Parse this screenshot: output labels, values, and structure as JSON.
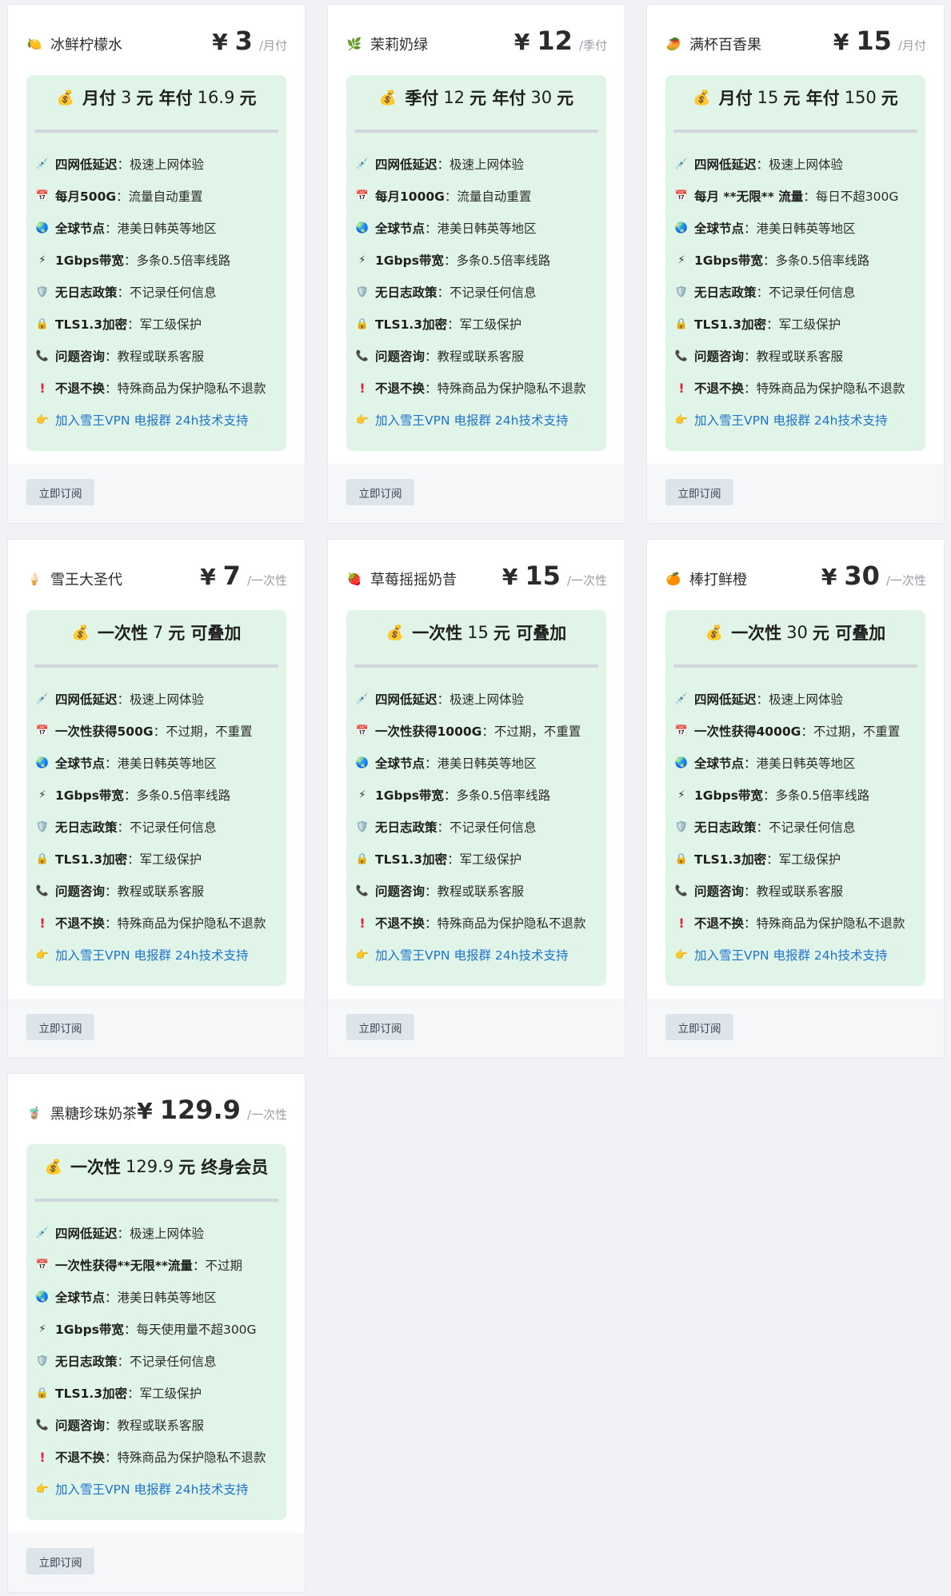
{
  "subscribe_label": "立即订阅",
  "cards": [
    {
      "name": "冰鲜柠檬水",
      "icon": "lemon-icon",
      "icon_glyph": "🍋",
      "currency": "¥",
      "price": "3",
      "unit": "/月付",
      "summary": {
        "prefix": "月付",
        "num1": "3",
        "mid": "元 年付",
        "num2": "16.9",
        "suffix": "元"
      },
      "features": [
        {
          "icon": "syringe-icon",
          "glyph": "💉",
          "bold": "四网低延迟",
          "sep": "：",
          "text": "极速上网体验"
        },
        {
          "icon": "calendar-icon",
          "glyph": "📅",
          "bold": "每月500G",
          "sep": "：",
          "text": "流量自动重置"
        },
        {
          "icon": "globe-icon",
          "glyph": "🌏",
          "bold": "全球节点",
          "sep": "：",
          "text": "港美日韩英等地区"
        },
        {
          "icon": "lightning-icon",
          "glyph": "⚡",
          "bold": "1Gbps带宽",
          "sep": "：",
          "text": "多条0.5倍率线路"
        },
        {
          "icon": "shield-icon",
          "glyph": "🛡️",
          "bold": "无日志政策",
          "sep": "：",
          "text": "不记录任何信息"
        },
        {
          "icon": "lock-icon",
          "glyph": "🔒",
          "bold": "TLS1.3加密",
          "sep": "：",
          "text": "军工级保护"
        },
        {
          "icon": "phone-icon",
          "glyph": "📞",
          "bold": "问题咨询",
          "sep": "：",
          "text": "教程或联系客服"
        },
        {
          "icon": "exclamation-icon",
          "glyph": "!",
          "bold": "不退不换",
          "sep": "：",
          "text": "特殊商品为保护隐私不退款"
        }
      ],
      "link": {
        "icon": "pointing-hand-icon",
        "glyph": "👉",
        "text": "加入雪王VPN 电报群 24h技术支持"
      }
    },
    {
      "name": "茉莉奶绿",
      "icon": "herb-icon",
      "icon_glyph": "🌿",
      "currency": "¥",
      "price": "12",
      "unit": "/季付",
      "summary": {
        "prefix": "季付",
        "num1": "12",
        "mid": "元 年付",
        "num2": "30",
        "suffix": "元"
      },
      "features": [
        {
          "icon": "syringe-icon",
          "glyph": "💉",
          "bold": "四网低延迟",
          "sep": "：",
          "text": "极速上网体验"
        },
        {
          "icon": "calendar-icon",
          "glyph": "📅",
          "bold": "每月1000G",
          "sep": "：",
          "text": "流量自动重置"
        },
        {
          "icon": "globe-icon",
          "glyph": "🌏",
          "bold": "全球节点",
          "sep": "：",
          "text": "港美日韩英等地区"
        },
        {
          "icon": "lightning-icon",
          "glyph": "⚡",
          "bold": "1Gbps带宽",
          "sep": "：",
          "text": "多条0.5倍率线路"
        },
        {
          "icon": "shield-icon",
          "glyph": "🛡️",
          "bold": "无日志政策",
          "sep": "：",
          "text": "不记录任何信息"
        },
        {
          "icon": "lock-icon",
          "glyph": "🔒",
          "bold": "TLS1.3加密",
          "sep": "：",
          "text": "军工级保护"
        },
        {
          "icon": "phone-icon",
          "glyph": "📞",
          "bold": "问题咨询",
          "sep": "：",
          "text": "教程或联系客服"
        },
        {
          "icon": "exclamation-icon",
          "glyph": "!",
          "bold": "不退不换",
          "sep": "：",
          "text": "特殊商品为保护隐私不退款"
        }
      ],
      "link": {
        "icon": "pointing-hand-icon",
        "glyph": "👉",
        "text": "加入雪王VPN 电报群 24h技术支持"
      }
    },
    {
      "name": "满杯百香果",
      "icon": "mango-icon",
      "icon_glyph": "🥭",
      "currency": "¥",
      "price": "15",
      "unit": "/月付",
      "summary": {
        "prefix": "月付",
        "num1": "15",
        "mid": "元 年付",
        "num2": "150",
        "suffix": "元"
      },
      "features": [
        {
          "icon": "syringe-icon",
          "glyph": "💉",
          "bold": "四网低延迟",
          "sep": "：",
          "text": "极速上网体验"
        },
        {
          "icon": "calendar-icon",
          "glyph": "📅",
          "bold": "每月 **无限** 流量",
          "sep": "：",
          "text": "每日不超300G"
        },
        {
          "icon": "globe-icon",
          "glyph": "🌏",
          "bold": "全球节点",
          "sep": "：",
          "text": "港美日韩英等地区"
        },
        {
          "icon": "lightning-icon",
          "glyph": "⚡",
          "bold": "1Gbps带宽",
          "sep": "：",
          "text": "多条0.5倍率线路"
        },
        {
          "icon": "shield-icon",
          "glyph": "🛡️",
          "bold": "无日志政策",
          "sep": "：",
          "text": "不记录任何信息"
        },
        {
          "icon": "lock-icon",
          "glyph": "🔒",
          "bold": "TLS1.3加密",
          "sep": "：",
          "text": "军工级保护"
        },
        {
          "icon": "phone-icon",
          "glyph": "📞",
          "bold": "问题咨询",
          "sep": "：",
          "text": "教程或联系客服"
        },
        {
          "icon": "exclamation-icon",
          "glyph": "!",
          "bold": "不退不换",
          "sep": "：",
          "text": "特殊商品为保护隐私不退款"
        }
      ],
      "link": {
        "icon": "pointing-hand-icon",
        "glyph": "👉",
        "text": "加入雪王VPN 电报群 24h技术支持"
      }
    },
    {
      "name": "雪王大圣代",
      "icon": "ice-cream-icon",
      "icon_glyph": "🍦",
      "currency": "¥",
      "price": "7",
      "unit": "/一次性",
      "summary": {
        "prefix": "一次性",
        "num1": "7",
        "mid": "元 可叠加",
        "num2": "",
        "suffix": ""
      },
      "features": [
        {
          "icon": "syringe-icon",
          "glyph": "💉",
          "bold": "四网低延迟",
          "sep": "：",
          "text": "极速上网体验"
        },
        {
          "icon": "calendar-icon",
          "glyph": "📅",
          "bold": "一次性获得500G",
          "sep": "：",
          "text": "不过期，不重置"
        },
        {
          "icon": "globe-icon",
          "glyph": "🌏",
          "bold": "全球节点",
          "sep": "：",
          "text": "港美日韩英等地区"
        },
        {
          "icon": "lightning-icon",
          "glyph": "⚡",
          "bold": "1Gbps带宽",
          "sep": "：",
          "text": "多条0.5倍率线路"
        },
        {
          "icon": "shield-icon",
          "glyph": "🛡️",
          "bold": "无日志政策",
          "sep": "：",
          "text": "不记录任何信息"
        },
        {
          "icon": "lock-icon",
          "glyph": "🔒",
          "bold": "TLS1.3加密",
          "sep": "：",
          "text": "军工级保护"
        },
        {
          "icon": "phone-icon",
          "glyph": "📞",
          "bold": "问题咨询",
          "sep": "：",
          "text": "教程或联系客服"
        },
        {
          "icon": "exclamation-icon",
          "glyph": "!",
          "bold": "不退不换",
          "sep": "：",
          "text": "特殊商品为保护隐私不退款"
        }
      ],
      "link": {
        "icon": "pointing-hand-icon",
        "glyph": "👉",
        "text": "加入雪王VPN 电报群 24h技术支持"
      }
    },
    {
      "name": "草莓摇摇奶昔",
      "icon": "strawberry-icon",
      "icon_glyph": "🍓",
      "currency": "¥",
      "price": "15",
      "unit": "/一次性",
      "summary": {
        "prefix": "一次性",
        "num1": "15",
        "mid": "元 可叠加",
        "num2": "",
        "suffix": ""
      },
      "features": [
        {
          "icon": "syringe-icon",
          "glyph": "💉",
          "bold": "四网低延迟",
          "sep": "：",
          "text": "极速上网体验"
        },
        {
          "icon": "calendar-icon",
          "glyph": "📅",
          "bold": "一次性获得1000G",
          "sep": "：",
          "text": "不过期，不重置"
        },
        {
          "icon": "globe-icon",
          "glyph": "🌏",
          "bold": "全球节点",
          "sep": "：",
          "text": "港美日韩英等地区"
        },
        {
          "icon": "lightning-icon",
          "glyph": "⚡",
          "bold": "1Gbps带宽",
          "sep": "：",
          "text": "多条0.5倍率线路"
        },
        {
          "icon": "shield-icon",
          "glyph": "🛡️",
          "bold": "无日志政策",
          "sep": "：",
          "text": "不记录任何信息"
        },
        {
          "icon": "lock-icon",
          "glyph": "🔒",
          "bold": "TLS1.3加密",
          "sep": "：",
          "text": "军工级保护"
        },
        {
          "icon": "phone-icon",
          "glyph": "📞",
          "bold": "问题咨询",
          "sep": "：",
          "text": "教程或联系客服"
        },
        {
          "icon": "exclamation-icon",
          "glyph": "!",
          "bold": "不退不换",
          "sep": "：",
          "text": "特殊商品为保护隐私不退款"
        }
      ],
      "link": {
        "icon": "pointing-hand-icon",
        "glyph": "👉",
        "text": "加入雪王VPN 电报群 24h技术支持"
      }
    },
    {
      "name": "棒打鲜橙",
      "icon": "orange-icon",
      "icon_glyph": "🍊",
      "currency": "¥",
      "price": "30",
      "unit": "/一次性",
      "summary": {
        "prefix": "一次性",
        "num1": "30",
        "mid": "元 可叠加",
        "num2": "",
        "suffix": ""
      },
      "features": [
        {
          "icon": "syringe-icon",
          "glyph": "💉",
          "bold": "四网低延迟",
          "sep": "：",
          "text": "极速上网体验"
        },
        {
          "icon": "calendar-icon",
          "glyph": "📅",
          "bold": "一次性获得4000G",
          "sep": "：",
          "text": "不过期，不重置"
        },
        {
          "icon": "globe-icon",
          "glyph": "🌏",
          "bold": "全球节点",
          "sep": "：",
          "text": "港美日韩英等地区"
        },
        {
          "icon": "lightning-icon",
          "glyph": "⚡",
          "bold": "1Gbps带宽",
          "sep": "：",
          "text": "多条0.5倍率线路"
        },
        {
          "icon": "shield-icon",
          "glyph": "🛡️",
          "bold": "无日志政策",
          "sep": "：",
          "text": "不记录任何信息"
        },
        {
          "icon": "lock-icon",
          "glyph": "🔒",
          "bold": "TLS1.3加密",
          "sep": "：",
          "text": "军工级保护"
        },
        {
          "icon": "phone-icon",
          "glyph": "📞",
          "bold": "问题咨询",
          "sep": "：",
          "text": "教程或联系客服"
        },
        {
          "icon": "exclamation-icon",
          "glyph": "!",
          "bold": "不退不换",
          "sep": "：",
          "text": "特殊商品为保护隐私不退款"
        }
      ],
      "link": {
        "icon": "pointing-hand-icon",
        "glyph": "👉",
        "text": "加入雪王VPN 电报群 24h技术支持"
      }
    },
    {
      "name": "黑糖珍珠奶茶",
      "icon": "bubble-tea-icon",
      "icon_glyph": "🧋",
      "currency": "¥",
      "price": "129.9",
      "unit": "/一次性",
      "summary": {
        "prefix": "一次性",
        "num1": "129.9",
        "mid": "元 终身会员",
        "num2": "",
        "suffix": ""
      },
      "features": [
        {
          "icon": "syringe-icon",
          "glyph": "💉",
          "bold": "四网低延迟",
          "sep": "：",
          "text": "极速上网体验"
        },
        {
          "icon": "calendar-icon",
          "glyph": "📅",
          "bold": "一次性获得**无限**流量",
          "sep": "：",
          "text": "不过期"
        },
        {
          "icon": "globe-icon",
          "glyph": "🌏",
          "bold": "全球节点",
          "sep": "：",
          "text": "港美日韩英等地区"
        },
        {
          "icon": "lightning-icon",
          "glyph": "⚡",
          "bold": "1Gbps带宽",
          "sep": "：",
          "text": "每天使用量不超300G"
        },
        {
          "icon": "shield-icon",
          "glyph": "🛡️",
          "bold": "无日志政策",
          "sep": "：",
          "text": "不记录任何信息"
        },
        {
          "icon": "lock-icon",
          "glyph": "🔒",
          "bold": "TLS1.3加密",
          "sep": "：",
          "text": "军工级保护"
        },
        {
          "icon": "phone-icon",
          "glyph": "📞",
          "bold": "问题咨询",
          "sep": "：",
          "text": "教程或联系客服"
        },
        {
          "icon": "exclamation-icon",
          "glyph": "!",
          "bold": "不退不换",
          "sep": "：",
          "text": "特殊商品为保护隐私不退款"
        }
      ],
      "link": {
        "icon": "pointing-hand-icon",
        "glyph": "👉",
        "text": "加入雪王VPN 电报群 24h技术支持"
      }
    }
  ]
}
